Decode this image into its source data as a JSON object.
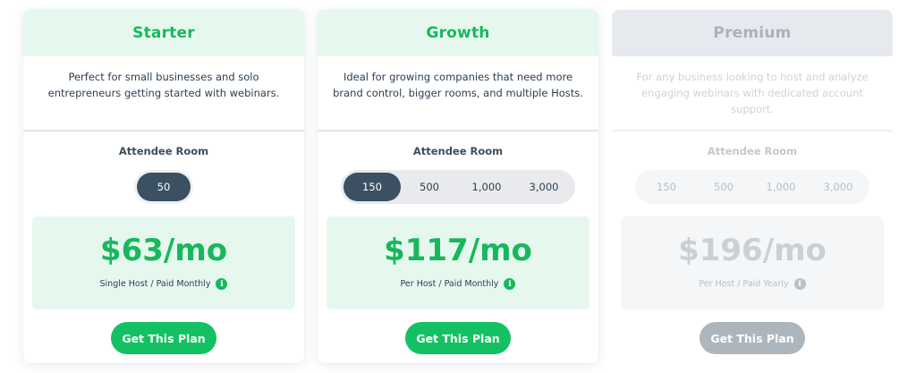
{
  "plans": [
    {
      "name": "Starter",
      "description": "Perfect for small businesses and solo entrepreneurs getting started with webinars.",
      "room_title": "Attendee Room",
      "rooms": [
        "50"
      ],
      "selected_room": "50",
      "price": "$63/mo",
      "billing": "Single Host / Paid Monthly",
      "cta": "Get This Plan"
    },
    {
      "name": "Growth",
      "description": "Ideal for growing companies that need more brand control, bigger rooms, and multiple Hosts.",
      "room_title": "Attendee Room",
      "rooms": [
        "150",
        "500",
        "1,000",
        "3,000"
      ],
      "selected_room": "150",
      "price": "$117/mo",
      "billing": "Per Host / Paid Monthly",
      "cta": "Get This Plan"
    },
    {
      "name": "Premium",
      "description": "For any business looking to host and analyze engaging webinars with dedicated account support.",
      "room_title": "Attendee Room",
      "rooms": [
        "150",
        "500",
        "1,000",
        "3,000"
      ],
      "selected_room": "",
      "price": "$196/mo",
      "billing": "Per Host / Paid Yearly",
      "cta": "Get This Plan"
    }
  ],
  "icons": {
    "info": "info-icon"
  },
  "colors": {
    "accent": "#17b85d",
    "selected_pill": "#3b5063",
    "disabled": "#aeb6bd"
  }
}
